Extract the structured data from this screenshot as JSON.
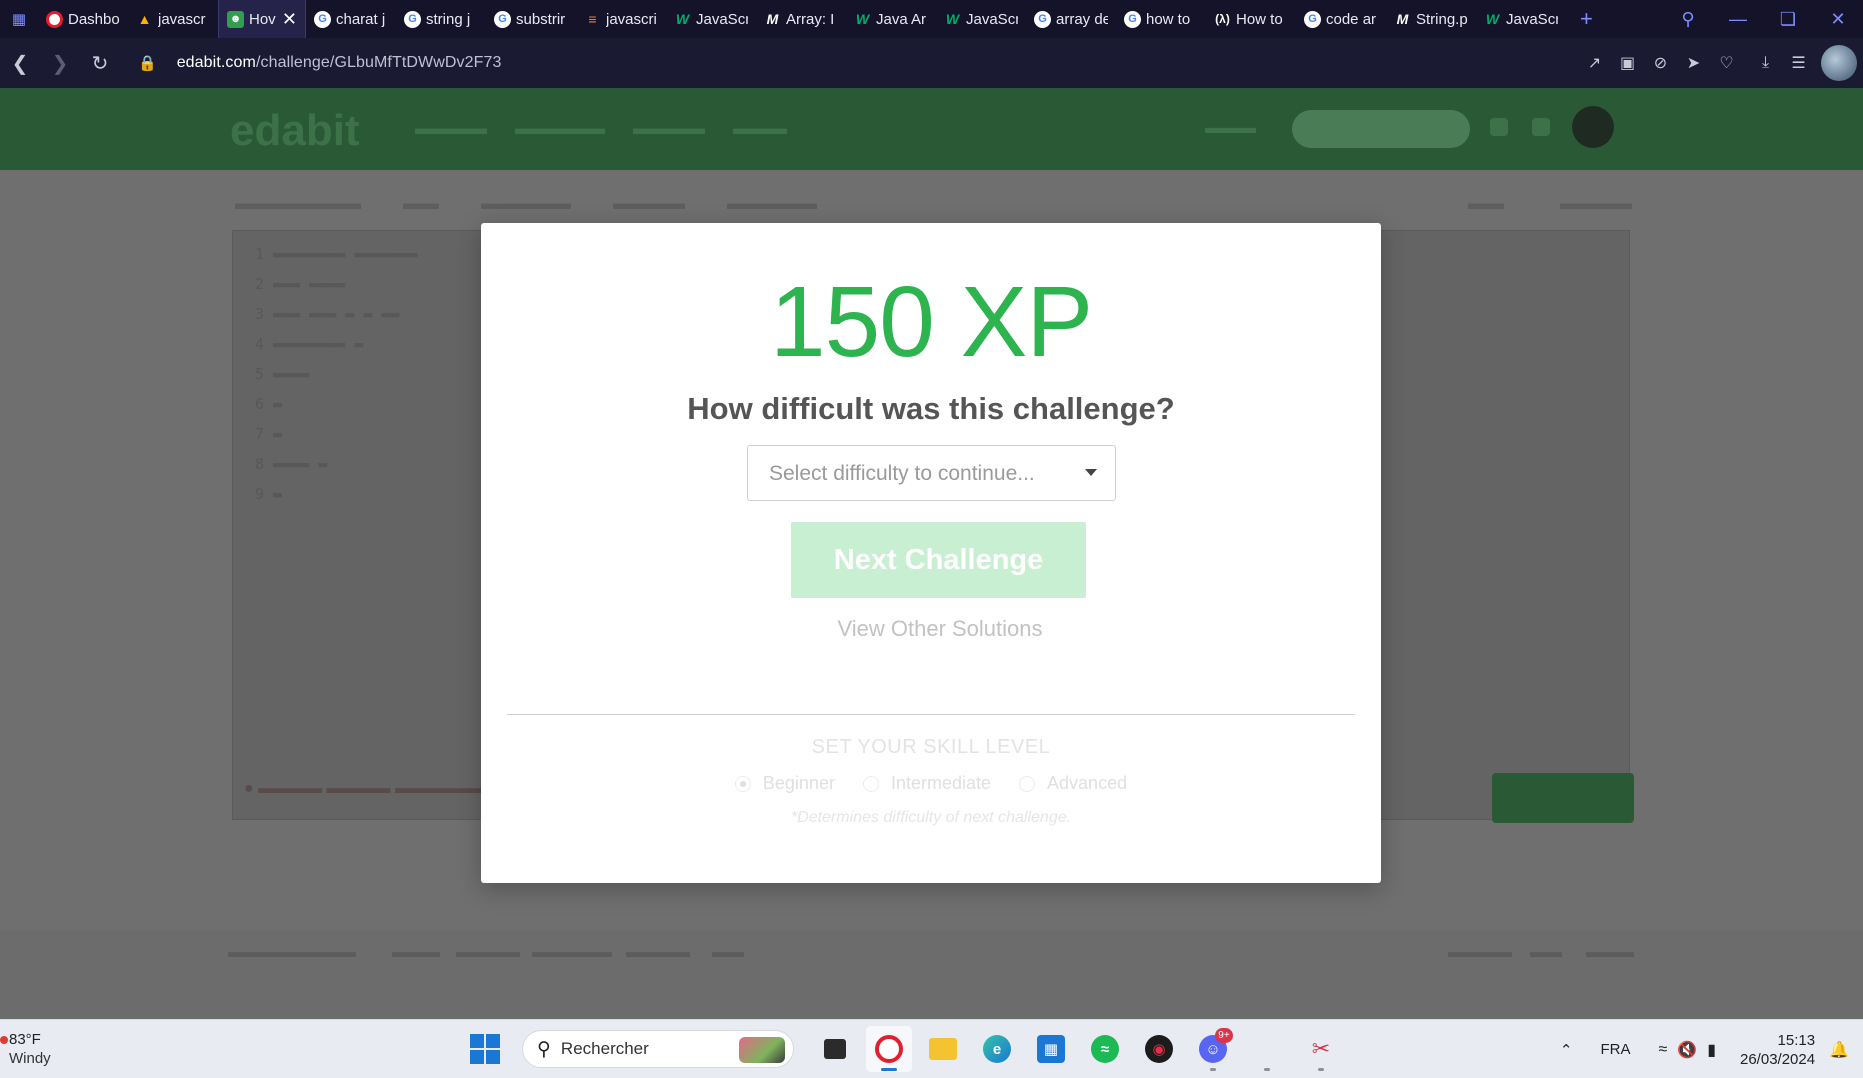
{
  "browser": {
    "tabs": [
      {
        "title": "Dashbo",
        "icon": "opera"
      },
      {
        "title": "javascr",
        "icon": "drive"
      },
      {
        "title": "Hov",
        "icon": "edabit",
        "active": true
      },
      {
        "title": "charat j",
        "icon": "google"
      },
      {
        "title": "string j",
        "icon": "google"
      },
      {
        "title": "substrir",
        "icon": "google"
      },
      {
        "title": "javascri",
        "icon": "stackoverflow"
      },
      {
        "title": "JavaScr",
        "icon": "w3schools"
      },
      {
        "title": "Array: I",
        "icon": "mdn"
      },
      {
        "title": "Java Ar",
        "icon": "w3schools"
      },
      {
        "title": "JavaScr",
        "icon": "w3schools"
      },
      {
        "title": "array de",
        "icon": "google"
      },
      {
        "title": "how to",
        "icon": "google"
      },
      {
        "title": "How to",
        "icon": "freecodecamp"
      },
      {
        "title": "code ar",
        "icon": "google"
      },
      {
        "title": "String.p",
        "icon": "mdn"
      },
      {
        "title": "JavaScr",
        "icon": "w3schools"
      }
    ],
    "url_host": "edabit.com",
    "url_path": "/challenge/GLbuMfTtDWwDv2F73"
  },
  "modal": {
    "xp": "150 XP",
    "question": "How difficult was this challenge?",
    "select_placeholder": "Select difficulty to continue...",
    "next_button": "Next Challenge",
    "other_solutions": "View Other Solutions",
    "skill_title": "SET YOUR SKILL LEVEL",
    "skill_options": [
      {
        "label": "Beginner",
        "selected": true
      },
      {
        "label": "Intermediate",
        "selected": false
      },
      {
        "label": "Advanced",
        "selected": false
      }
    ],
    "skill_note": "*Determines difficulty of next challenge."
  },
  "taskbar": {
    "weather_temp": "83°F",
    "weather_desc": "Windy",
    "search_placeholder": "Rechercher",
    "language": "FRA",
    "time": "15:13",
    "date": "26/03/2024",
    "discord_badge": "9+"
  },
  "colors": {
    "accent_green": "#2eb44f",
    "disabled_button": "#c9efd3",
    "tabstrip_bg": "#14132a"
  }
}
